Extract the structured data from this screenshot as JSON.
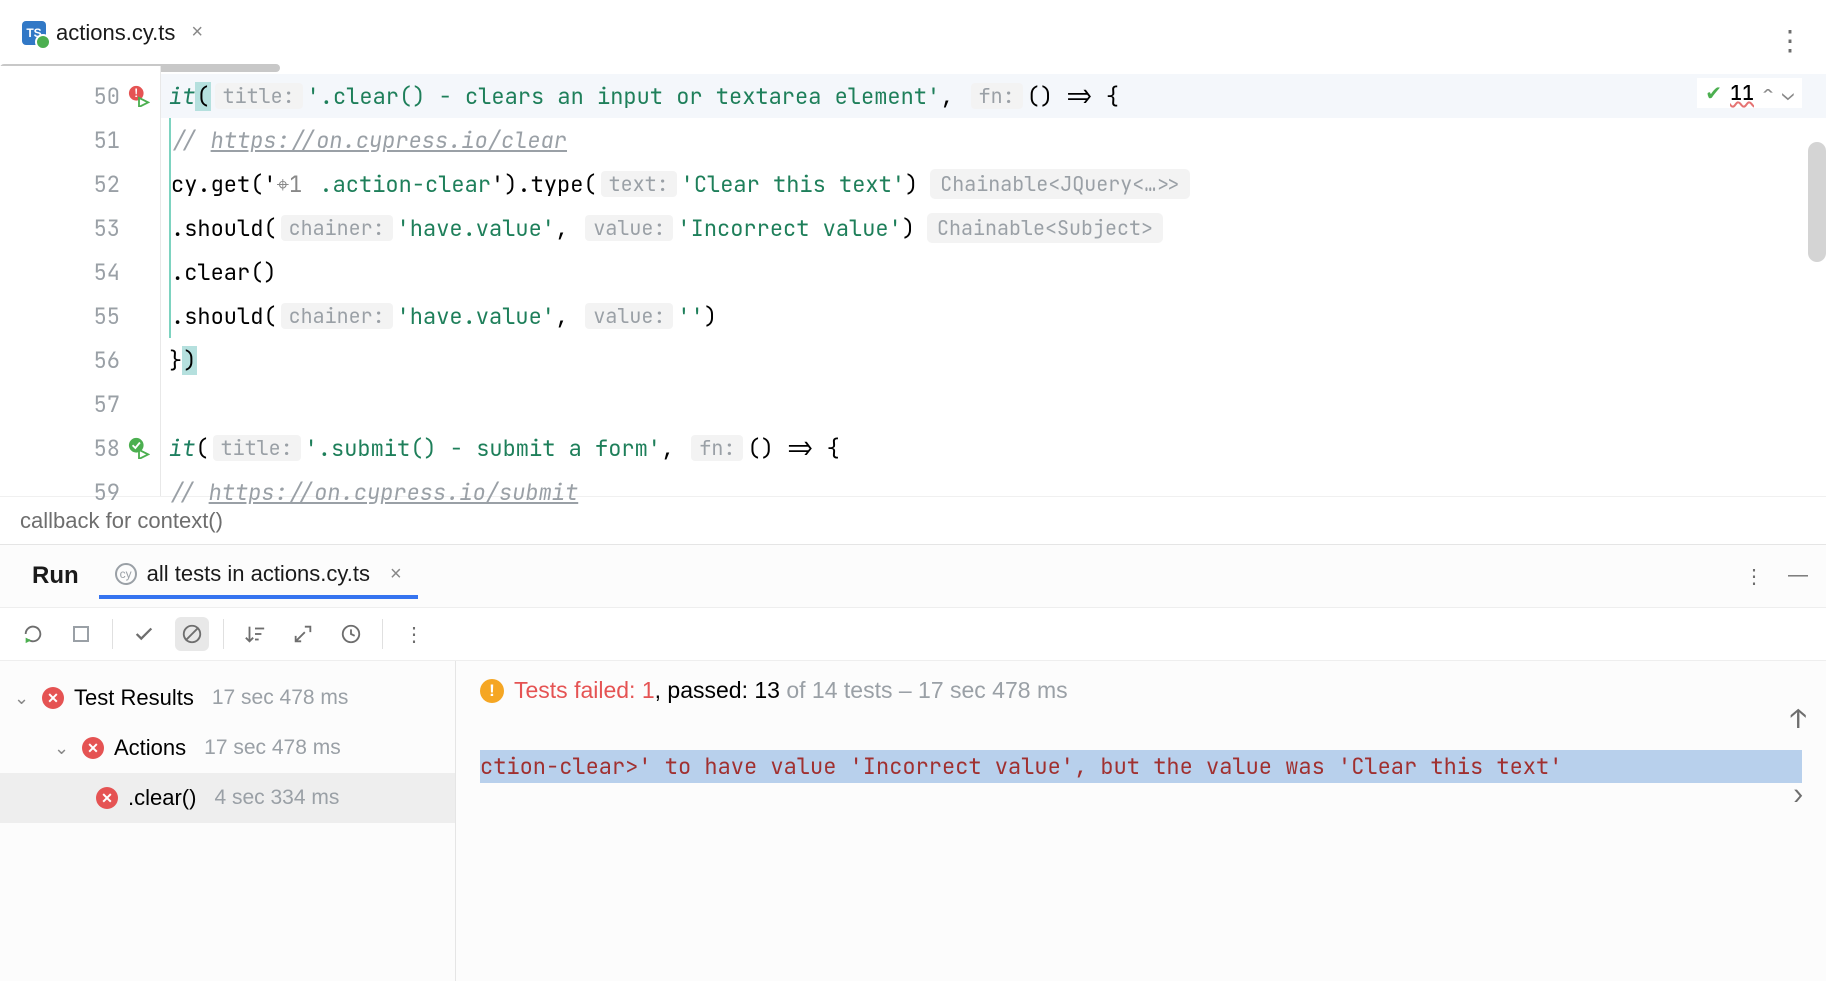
{
  "tab": {
    "filename": "actions.cy.ts"
  },
  "inspections": {
    "count": "11"
  },
  "code": {
    "lines": [
      {
        "n": "50",
        "gutter": "fail",
        "hl": true
      },
      {
        "n": "51"
      },
      {
        "n": "52"
      },
      {
        "n": "53"
      },
      {
        "n": "54"
      },
      {
        "n": "55"
      },
      {
        "n": "56"
      },
      {
        "n": "57"
      },
      {
        "n": "58",
        "gutter": "pass"
      },
      {
        "n": "59"
      }
    ],
    "l50": {
      "fn": "it",
      "hint_title": "title:",
      "str_title": "'.clear() - clears an input or textarea element'",
      "hint_fn": "fn:",
      "arrow": "() => {"
    },
    "l51": {
      "comment": "// ",
      "link": "https://on.cypress.io/clear"
    },
    "l52": {
      "pre": "cy.get(",
      "ref": "1",
      "sel": " .action-clear",
      "mid": ").type(",
      "hint_text": "text:",
      "str_text": "'Clear this text'",
      "end": ")",
      "inlay": "Chainable<JQuery<…>>"
    },
    "l53": {
      "pre": ".should(",
      "hint_ch": "chainer:",
      "str_ch": "'have.value'",
      "sep": ", ",
      "hint_val": "value:",
      "str_val": "'Incorrect value'",
      "end": ")",
      "inlay": "Chainable<Subject>"
    },
    "l54": {
      "text": ".clear()"
    },
    "l55": {
      "pre": ".should(",
      "hint_ch": "chainer:",
      "str_ch": "'have.value'",
      "sep": ", ",
      "hint_val": "value:",
      "str_val": "''",
      "end": ")"
    },
    "l56": {
      "text": "})"
    },
    "l58": {
      "fn": "it",
      "hint_title": "title:",
      "str_title": "'.submit() - submit a form'",
      "hint_fn": "fn:",
      "arrow": "() => {"
    },
    "l59": {
      "comment": "// ",
      "link": "https://on.cypress.io/submit"
    }
  },
  "breadcrumb": "callback for context()",
  "run": {
    "tab_label": "Run",
    "config": "all tests in actions.cy.ts"
  },
  "tree": {
    "root": {
      "label": "Test Results",
      "dur": "17 sec 478 ms"
    },
    "suite": {
      "label": "Actions",
      "dur": "17 sec 478 ms"
    },
    "test": {
      "label": ".clear()",
      "dur": "4 sec 334 ms"
    }
  },
  "summary": {
    "fail_label": "Tests failed: 1",
    "pass_label": ", passed: 13",
    "grey": " of 14 tests – 17 sec 478 ms"
  },
  "error_text": "ction-clear>' to have value 'Incorrect value', but the value was 'Clear this text'"
}
